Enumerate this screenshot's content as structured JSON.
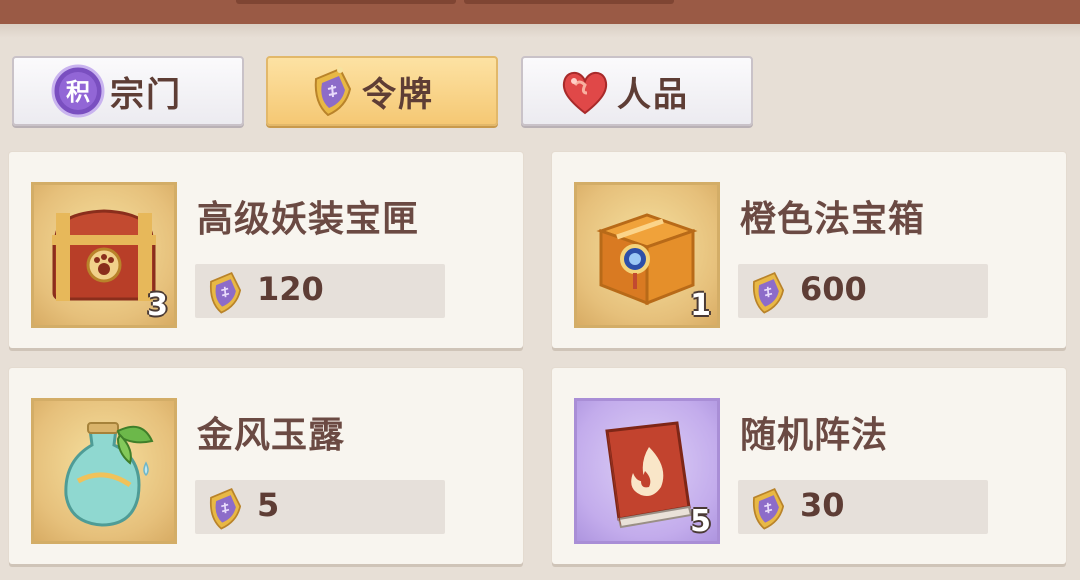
{
  "tabs": [
    {
      "label": "宗门",
      "icon": "purple-ji-coin-icon",
      "icon_text": "积",
      "active": false
    },
    {
      "label": "令牌",
      "icon": "token-medal-icon",
      "active": true
    },
    {
      "label": "人品",
      "icon": "heart-icon",
      "active": false
    }
  ],
  "items": [
    {
      "name": "高级妖装宝匣",
      "count": "3",
      "price": "120",
      "icon": "red-gold-treasure-chest-icon",
      "currency_icon": "token-medal-icon"
    },
    {
      "name": "橙色法宝箱",
      "count": "1",
      "price": "600",
      "icon": "orange-magic-chest-icon",
      "currency_icon": "token-medal-icon"
    },
    {
      "name": "金风玉露",
      "count": "",
      "price": "5",
      "icon": "jade-bottle-icon",
      "currency_icon": "token-medal-icon"
    },
    {
      "name": "随机阵法",
      "count": "5",
      "price": "30",
      "icon": "fire-book-icon",
      "currency_icon": "token-medal-icon"
    }
  ],
  "colors": {
    "accent": "#f5c874",
    "bar": "#9a5a45",
    "text": "#5e3d35"
  }
}
